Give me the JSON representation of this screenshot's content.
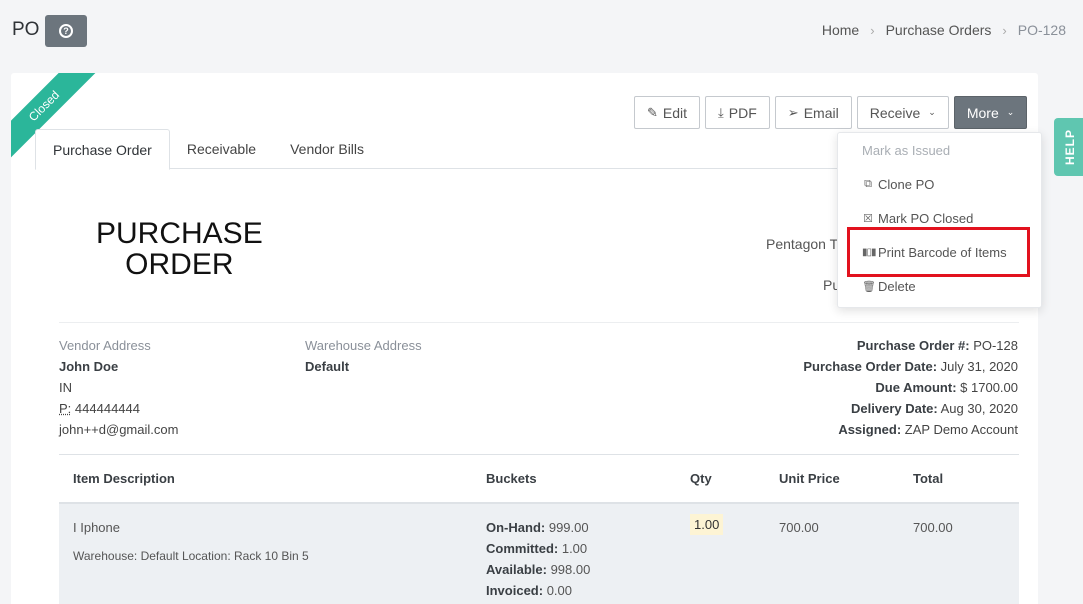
{
  "header": {
    "title": "PO",
    "help_icon": "question-circle-icon"
  },
  "breadcrumb": {
    "home": "Home",
    "section": "Purchase Orders",
    "current": "PO-128"
  },
  "ribbon": {
    "label": "Closed",
    "color": "#2bb69a"
  },
  "toolbar": {
    "edit": "Edit",
    "pdf": "PDF",
    "email": "Email",
    "receive": "Receive",
    "more": "More"
  },
  "tabs": [
    {
      "label": "Purchase Order",
      "active": true
    },
    {
      "label": "Receivable",
      "active": false
    },
    {
      "label": "Vendor Bills",
      "active": false
    }
  ],
  "document": {
    "heading_line1": "PURCHASE",
    "heading_line2": "ORDER",
    "company_partial": "Pentagon T",
    "company_partial2": "Pu"
  },
  "vendor": {
    "label": "Vendor Address",
    "name": "John Doe",
    "country": "IN",
    "phone_label": "P:",
    "phone": "444444444",
    "email": "john++d@gmail.com"
  },
  "warehouse": {
    "label": "Warehouse Address",
    "name": "Default"
  },
  "po_info": {
    "number_label": "Purchase Order #:",
    "number": "PO-128",
    "date_label": "Purchase Order Date:",
    "date": "July 31, 2020",
    "due_label": "Due Amount:",
    "due": "$ 1700.00",
    "delivery_label": "Delivery Date:",
    "delivery": "Aug 30, 2020",
    "assigned_label": "Assigned:",
    "assigned": "ZAP Demo Account"
  },
  "table": {
    "headers": {
      "description": "Item Description",
      "buckets": "Buckets",
      "qty": "Qty",
      "unit_price": "Unit Price",
      "total": "Total"
    },
    "rows": [
      {
        "name": "I Iphone",
        "location": "Warehouse: Default Location: Rack 10 Bin 5",
        "onhand_label": "On-Hand:",
        "onhand": "999.00",
        "committed_label": "Committed:",
        "committed": "1.00",
        "available_label": "Available:",
        "available": "998.00",
        "invoiced_label": "Invoiced:",
        "invoiced": "0.00",
        "qty": "1.00",
        "unit_price": "700.00",
        "total": "700.00"
      }
    ]
  },
  "more_menu": {
    "items": [
      {
        "label": "Mark as Issued",
        "icon": "",
        "disabled": true
      },
      {
        "label": "Clone PO",
        "icon": "copy-icon",
        "disabled": false
      },
      {
        "label": "Mark PO Closed",
        "icon": "close-square-icon",
        "disabled": false
      },
      {
        "label": "Print Barcode of Items",
        "icon": "barcode-icon",
        "disabled": false
      },
      {
        "label": "Delete",
        "icon": "trash-icon",
        "disabled": false
      }
    ],
    "highlight_color": "#e2121e"
  },
  "help_tab": {
    "label": "HELP"
  }
}
